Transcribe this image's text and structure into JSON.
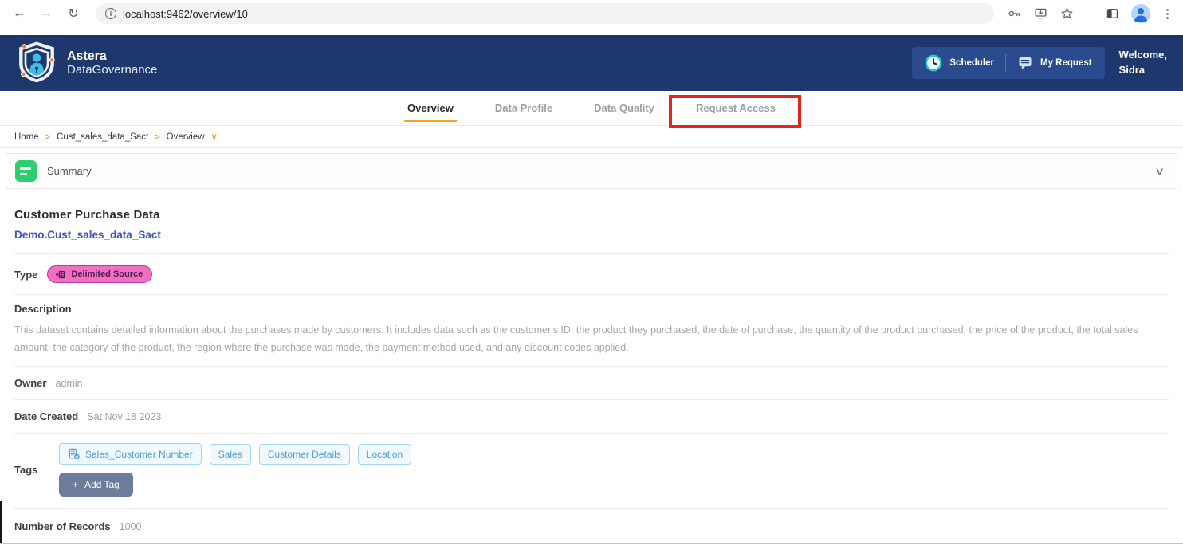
{
  "browser": {
    "url": "localhost:9462/overview/10"
  },
  "header": {
    "brand1": "Astera",
    "brand2": "DataGovernance",
    "scheduler": "Scheduler",
    "my_request": "My Request",
    "welcome1": "Welcome,",
    "welcome2": "Sidra"
  },
  "tabs": [
    {
      "label": "Overview"
    },
    {
      "label": "Data Profile"
    },
    {
      "label": "Data Quality"
    },
    {
      "label": "Request Access"
    }
  ],
  "breadcrumb": {
    "items": [
      "Home",
      "Cust_sales_data_Sact",
      "Overview"
    ]
  },
  "summary": {
    "title": "Summary"
  },
  "overview": {
    "title": "Customer Purchase Data",
    "qualified_name": "Demo.Cust_sales_data_Sact",
    "type_label": "Type",
    "type_badge": "Delimited Source",
    "description_label": "Description",
    "description_text": "This dataset contains detailed information about the purchases made by customers. It includes data such as the customer's ID, the product they purchased, the date of purchase, the quantity of the product purchased, the price of the product, the total sales amount, the category of the product, the region where the purchase was made, the payment method used, and any discount codes applied.",
    "owner_label": "Owner",
    "owner_value": "admin",
    "date_label": "Date Created",
    "date_value": "Sat Nov 18 2023",
    "tags_label": "Tags",
    "tags": [
      "Sales_Customer Number",
      "Sales",
      "Customer Details",
      "Location"
    ],
    "add_tag": {
      "plus": "+",
      "label": "Add Tag"
    },
    "records_label": "Number of Records",
    "records_value": "1000"
  },
  "colors": {
    "header_navy": "#1e386d",
    "accent_orange": "#f9a11b",
    "annotation_red": "#e1251b",
    "summary_green": "#2dcd70",
    "type_badge_pink": "#f06fc0",
    "tag_blue": "#4a9fd8",
    "link_blue": "#3a57c4",
    "add_tag_slate": "#6e7c9b"
  }
}
